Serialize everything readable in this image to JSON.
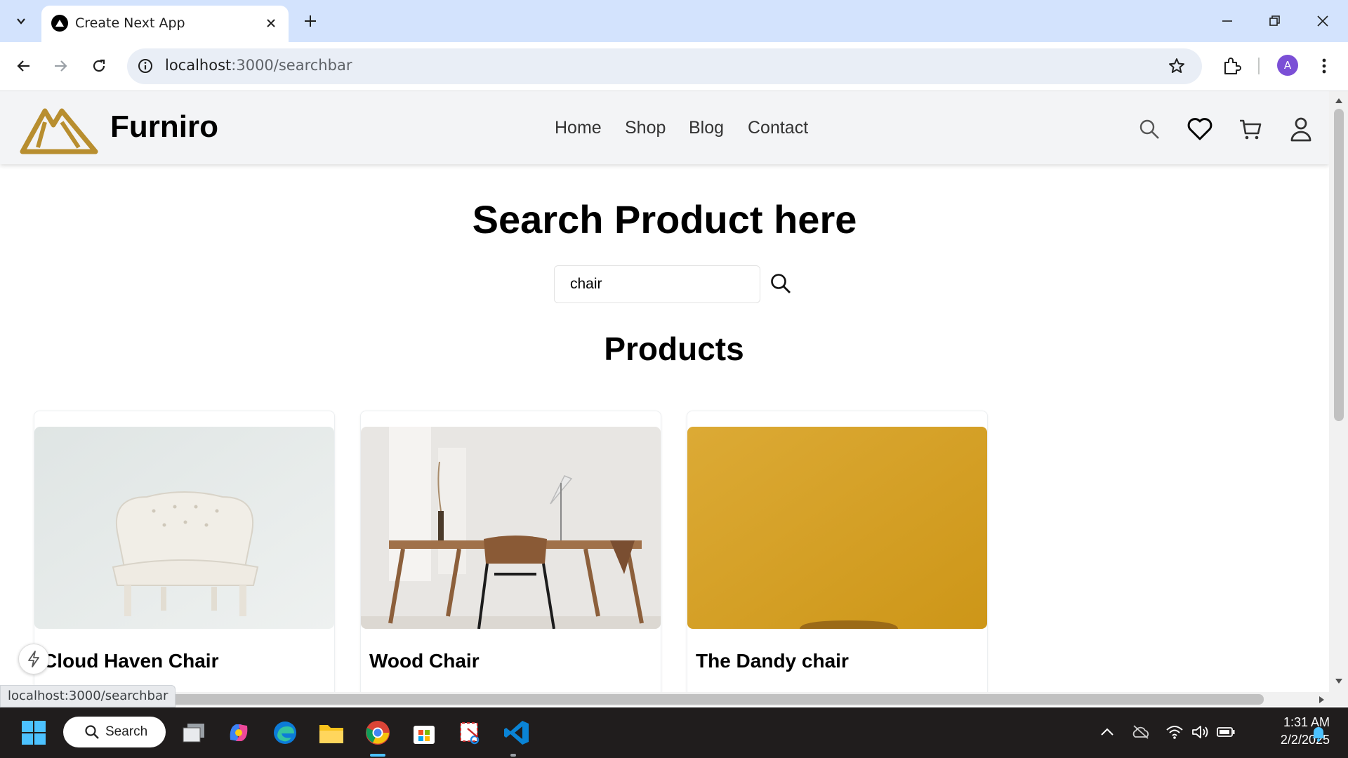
{
  "browser": {
    "tab_title": "Create Next App",
    "url_host": "localhost",
    "url_path": ":3000/searchbar",
    "profile_initial": "A",
    "status_url": "localhost:3000/searchbar"
  },
  "site": {
    "brand": "Furniro",
    "brand_color": "#b88e2f",
    "nav": [
      "Home",
      "Shop",
      "Blog",
      "Contact"
    ]
  },
  "page": {
    "title": "Search Product here",
    "search_value": "chair",
    "products_heading": "Products"
  },
  "products": [
    {
      "name": "Cloud Haven Chair"
    },
    {
      "name": "Wood Chair"
    },
    {
      "name": "The Dandy chair"
    }
  ],
  "taskbar": {
    "search_label": "Search",
    "time": "1:31 AM",
    "date": "2/2/2025"
  }
}
